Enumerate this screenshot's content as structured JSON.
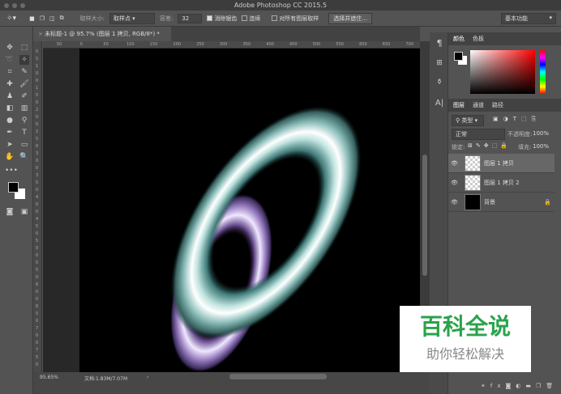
{
  "window": {
    "title": "Adobe Photoshop CC 2015.5"
  },
  "options": {
    "sample_size_label": "取样大小:",
    "sample_size_value": "取样点",
    "tolerance_label": "容差:",
    "tolerance_value": "32",
    "antialias_label": "消除锯齿",
    "antialias_checked": true,
    "contiguous_label": "连续",
    "contiguous_checked": false,
    "all_layers_label": "对所有图层取样",
    "all_layers_checked": false,
    "select_mask_label": "选择并遮住...",
    "workspace": "基本功能"
  },
  "document": {
    "tab_title": "未标题-1 @ 95.7% (图层 1 拷贝, RGB/8*) *",
    "ruler_h": [
      "50",
      "0",
      "50",
      "100",
      "150",
      "200",
      "250",
      "300",
      "350",
      "400",
      "450",
      "500",
      "550",
      "600",
      "650",
      "700"
    ],
    "ruler_v": [
      "0",
      "5",
      "1",
      "0",
      "0",
      "1",
      "5",
      "0",
      "2",
      "0",
      "0",
      "2",
      "5",
      "0",
      "3",
      "0",
      "0",
      "3",
      "5",
      "0",
      "4",
      "0",
      "0",
      "4",
      "5",
      "0",
      "5",
      "0",
      "0",
      "5",
      "5",
      "0",
      "6",
      "0",
      "0",
      "6",
      "5",
      "0",
      "7",
      "0",
      "0",
      "7",
      "5",
      "0"
    ]
  },
  "status": {
    "zoom": "95.65%",
    "doc_size": "文档:1.83M/7.07M"
  },
  "color_panel": {
    "tabs": [
      "颜色",
      "色板"
    ],
    "foreground": "#000000",
    "background": "#ffffff",
    "hue_color": "#ff0000"
  },
  "layers_panel": {
    "tabs": [
      "图层",
      "通道",
      "路径"
    ],
    "filter": "类型",
    "blend_mode": "正常",
    "opacity_label": "不透明度:",
    "opacity": "100%",
    "lock_label": "锁定:",
    "fill_label": "填充:",
    "fill": "100%",
    "layers": [
      {
        "name": "图层 1 拷贝",
        "visible": true,
        "selected": true
      },
      {
        "name": "图层 1 拷贝 2",
        "visible": true,
        "selected": false
      },
      {
        "name": "背景",
        "visible": true,
        "selected": false,
        "locked": true
      }
    ]
  },
  "watermark": {
    "title": "百科全说",
    "subtitle": "助你轻松解决",
    "color": "#2aa34a"
  }
}
